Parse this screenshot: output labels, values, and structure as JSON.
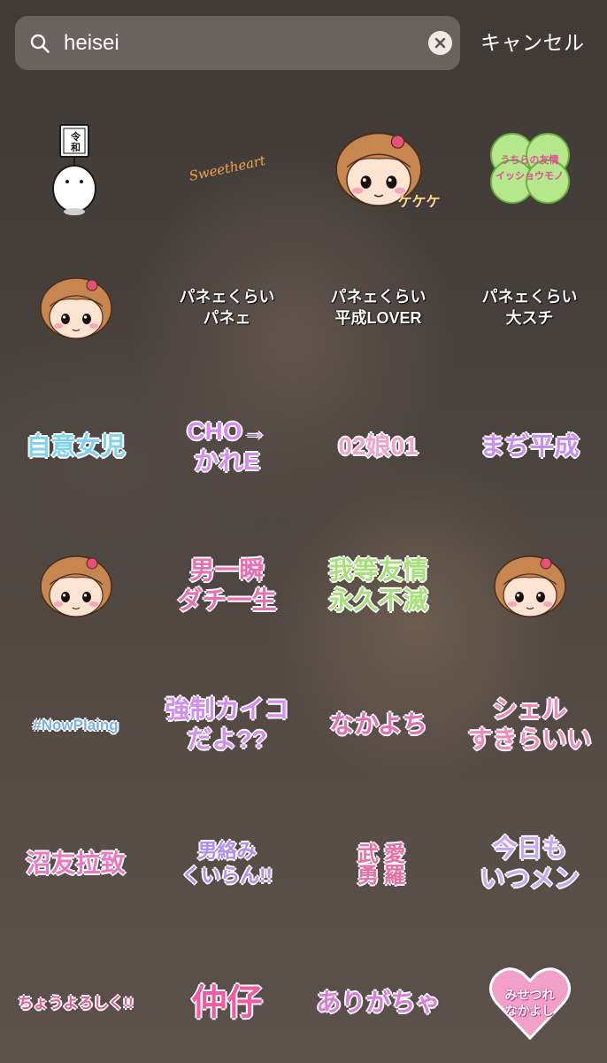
{
  "search": {
    "query": "heisei",
    "cancel_label": "キャンセル"
  },
  "stickers": [
    {
      "name": "sticker-reiwa-panda",
      "text": "令和",
      "kind": "panda"
    },
    {
      "name": "sticker-sweetheart",
      "text": "Sweetheart",
      "kind": "script",
      "color": "#f3a44c"
    },
    {
      "name": "sticker-girl-ribbon",
      "text": "ケケケ",
      "kind": "girl-big"
    },
    {
      "name": "sticker-clover",
      "text": "うちらの友情\nイッショウモノ",
      "kind": "clover",
      "color": "#b5e88c"
    },
    {
      "name": "sticker-girl-ponytail",
      "text": "",
      "kind": "girl-face"
    },
    {
      "name": "sticker-panee-1",
      "text": "パネェくらい\nパネェ",
      "kind": "plain",
      "color": "#ffffff"
    },
    {
      "name": "sticker-panee-2",
      "text": "パネェくらい\n平成LOVER",
      "kind": "plain",
      "color": "#ffffff"
    },
    {
      "name": "sticker-panee-3",
      "text": "パネェくらい\n大スチ",
      "kind": "plain",
      "color": "#ffffff"
    },
    {
      "name": "sticker-girl-jiko",
      "text": "自意女児",
      "kind": "colorful",
      "color": "#7fd3f0"
    },
    {
      "name": "sticker-cho-akogare",
      "text": "CHO→\nかれE",
      "kind": "colorful",
      "color": "#d98cf0"
    },
    {
      "name": "sticker-02-musume-01",
      "text": "02娘01",
      "kind": "colorful",
      "color": "#f2a3c7"
    },
    {
      "name": "sticker-maji-heisei",
      "text": "まぢ平成",
      "kind": "colorful",
      "color": "#c98cf0"
    },
    {
      "name": "sticker-girl-blue-ribbon",
      "text": "",
      "kind": "girl-face"
    },
    {
      "name": "sticker-otoko-ichishun",
      "text": "男一瞬\nダチ一生",
      "kind": "colorful",
      "color": "#e86fb2"
    },
    {
      "name": "sticker-yujo-eikyu",
      "text": "我等友情\n永久不滅",
      "kind": "colorful",
      "color": "#a7e07a"
    },
    {
      "name": "sticker-girl-pigtails",
      "text": "",
      "kind": "girl-face"
    },
    {
      "name": "sticker-nowplaying",
      "text": "#NowPlaing",
      "kind": "colorful",
      "color": "#7ab0ea"
    },
    {
      "name": "sticker-kyosei-kaiko",
      "text": "強制カイコ\nだよ??",
      "kind": "colorful",
      "color": "#d38cf0"
    },
    {
      "name": "sticker-nakayoshi",
      "text": "なかよち",
      "kind": "colorful",
      "color": "#e66fb0"
    },
    {
      "name": "sticker-sheru-suki",
      "text": "シェル\nすきらいい",
      "kind": "colorful",
      "color": "#f08ab5"
    },
    {
      "name": "sticker-kinyu",
      "text": "沼友拉致",
      "kind": "colorful",
      "color": "#e87ac2"
    },
    {
      "name": "sticker-danshi",
      "text": "男絡み\nくいらん!!",
      "kind": "colorful",
      "color": "#b48cf0"
    },
    {
      "name": "sticker-aira-busu",
      "text": "愛羅\n武勇",
      "kind": "colorful",
      "color": "#e86fa3"
    },
    {
      "name": "sticker-kyou-mo",
      "text": "今日も\nいつメン",
      "kind": "colorful",
      "color": "#c9a7f5"
    },
    {
      "name": "sticker-choyoroshiku",
      "text": "ちょうよろしく!!",
      "kind": "colorful",
      "color": "#e8588f"
    },
    {
      "name": "sticker-nakayoshi-kanji",
      "text": "仲仔",
      "kind": "colorful",
      "color": "#f05aa0"
    },
    {
      "name": "sticker-arigatou",
      "text": "ありがちゃ",
      "kind": "colorful",
      "color": "#d97fd5"
    },
    {
      "name": "sticker-heart-message",
      "text": "みせつれ\nなかよし",
      "kind": "heart",
      "color": "#f3a0c8"
    }
  ]
}
